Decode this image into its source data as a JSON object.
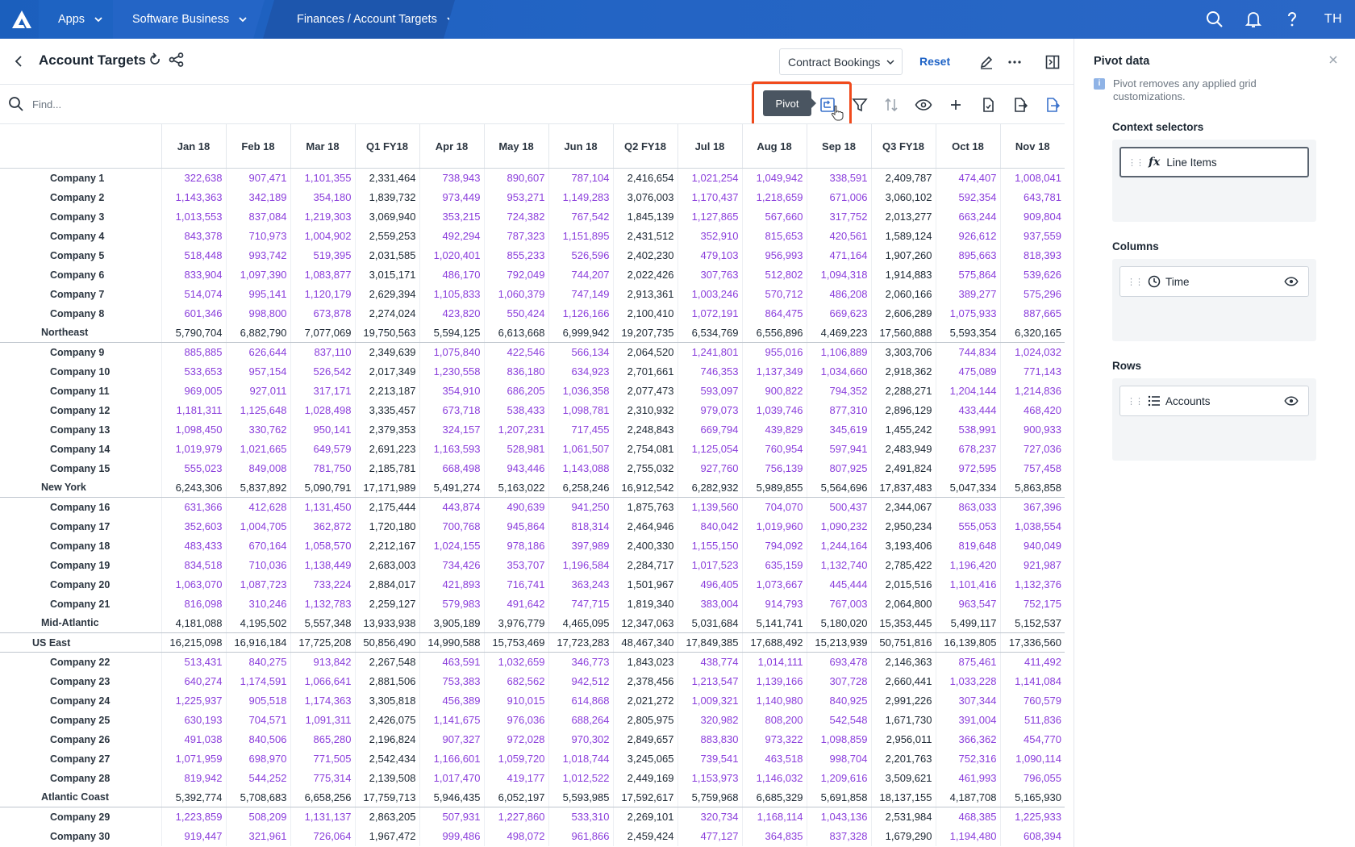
{
  "topnav": {
    "apps_label": "Apps",
    "workspace_label": "Software Business",
    "breadcrumb_label": "Finances / Account Targets",
    "user_initials": "TH"
  },
  "header": {
    "title": "Account Targets",
    "dropdown_value": "Contract Bookings",
    "reset_label": "Reset"
  },
  "toolbar": {
    "find_placeholder": "Find...",
    "tooltip": "Pivot"
  },
  "grid": {
    "columns": [
      "Jan 18",
      "Feb 18",
      "Mar 18",
      "Q1 FY18",
      "Apr 18",
      "May 18",
      "Jun 18",
      "Q2 FY18",
      "Jul 18",
      "Aug 18",
      "Sep 18",
      "Q3 FY18",
      "Oct 18",
      "Nov 18"
    ],
    "quarter_columns": [
      3,
      7,
      11
    ],
    "rows": [
      {
        "label": "Company 1",
        "type": "company",
        "values": [
          "322,638",
          "907,471",
          "1,101,355",
          "2,331,464",
          "738,943",
          "890,607",
          "787,104",
          "2,416,654",
          "1,021,254",
          "1,049,942",
          "338,591",
          "2,409,787",
          "474,407",
          "1,008,041"
        ]
      },
      {
        "label": "Company 2",
        "type": "company",
        "values": [
          "1,143,363",
          "342,189",
          "354,180",
          "1,839,732",
          "973,449",
          "953,271",
          "1,149,283",
          "3,076,003",
          "1,170,437",
          "1,218,659",
          "671,006",
          "3,060,102",
          "592,354",
          "643,781"
        ]
      },
      {
        "label": "Company 3",
        "type": "company",
        "values": [
          "1,013,553",
          "837,084",
          "1,219,303",
          "3,069,940",
          "353,215",
          "724,382",
          "767,542",
          "1,845,139",
          "1,127,865",
          "567,660",
          "317,752",
          "2,013,277",
          "663,244",
          "909,804"
        ]
      },
      {
        "label": "Company 4",
        "type": "company",
        "values": [
          "843,378",
          "710,973",
          "1,004,902",
          "2,559,253",
          "492,294",
          "787,323",
          "1,151,895",
          "2,431,512",
          "352,910",
          "815,653",
          "420,561",
          "1,589,124",
          "926,612",
          "937,559"
        ]
      },
      {
        "label": "Company 5",
        "type": "company",
        "values": [
          "518,448",
          "993,742",
          "519,395",
          "2,031,585",
          "1,020,401",
          "855,233",
          "526,596",
          "2,402,230",
          "479,103",
          "956,993",
          "471,164",
          "1,907,260",
          "895,663",
          "818,393"
        ]
      },
      {
        "label": "Company 6",
        "type": "company",
        "values": [
          "833,904",
          "1,097,390",
          "1,083,877",
          "3,015,171",
          "486,170",
          "792,049",
          "744,207",
          "2,022,426",
          "307,763",
          "512,802",
          "1,094,318",
          "1,914,883",
          "575,864",
          "539,626"
        ]
      },
      {
        "label": "Company 7",
        "type": "company",
        "values": [
          "514,074",
          "995,141",
          "1,120,179",
          "2,629,394",
          "1,105,833",
          "1,060,379",
          "747,149",
          "2,913,361",
          "1,003,246",
          "570,712",
          "486,208",
          "2,060,166",
          "389,277",
          "575,296"
        ]
      },
      {
        "label": "Company 8",
        "type": "company",
        "values": [
          "601,346",
          "998,800",
          "673,878",
          "2,274,024",
          "423,820",
          "550,424",
          "1,126,166",
          "2,100,410",
          "1,072,191",
          "864,475",
          "669,623",
          "2,606,289",
          "1,075,933",
          "887,665"
        ]
      },
      {
        "label": "Northeast",
        "type": "region",
        "values": [
          "5,790,704",
          "6,882,790",
          "7,077,069",
          "19,750,563",
          "5,594,125",
          "6,613,668",
          "6,999,942",
          "19,207,735",
          "6,534,769",
          "6,556,896",
          "4,469,223",
          "17,560,888",
          "5,593,354",
          "6,320,165"
        ]
      },
      {
        "label": "Company 9",
        "type": "company",
        "values": [
          "885,885",
          "626,644",
          "837,110",
          "2,349,639",
          "1,075,840",
          "422,546",
          "566,134",
          "2,064,520",
          "1,241,801",
          "955,016",
          "1,106,889",
          "3,303,706",
          "744,834",
          "1,024,032"
        ]
      },
      {
        "label": "Company 10",
        "type": "company",
        "values": [
          "533,653",
          "957,154",
          "526,542",
          "2,017,349",
          "1,230,558",
          "836,180",
          "634,923",
          "2,701,661",
          "746,353",
          "1,137,349",
          "1,034,660",
          "2,918,362",
          "475,089",
          "771,143"
        ]
      },
      {
        "label": "Company 11",
        "type": "company",
        "values": [
          "969,005",
          "927,011",
          "317,171",
          "2,213,187",
          "354,910",
          "686,205",
          "1,036,358",
          "2,077,473",
          "593,097",
          "900,822",
          "794,352",
          "2,288,271",
          "1,204,144",
          "1,214,836"
        ]
      },
      {
        "label": "Company 12",
        "type": "company",
        "values": [
          "1,181,311",
          "1,125,648",
          "1,028,498",
          "3,335,457",
          "673,718",
          "538,433",
          "1,098,781",
          "2,310,932",
          "979,073",
          "1,039,746",
          "877,310",
          "2,896,129",
          "433,444",
          "468,420"
        ]
      },
      {
        "label": "Company 13",
        "type": "company",
        "values": [
          "1,098,450",
          "330,762",
          "950,141",
          "2,379,353",
          "324,157",
          "1,207,231",
          "717,455",
          "2,248,843",
          "669,794",
          "439,829",
          "345,619",
          "1,455,242",
          "538,991",
          "900,933"
        ]
      },
      {
        "label": "Company 14",
        "type": "company",
        "values": [
          "1,019,979",
          "1,021,665",
          "649,579",
          "2,691,223",
          "1,163,593",
          "528,981",
          "1,061,507",
          "2,754,081",
          "1,125,054",
          "760,954",
          "597,941",
          "2,483,949",
          "678,237",
          "727,036"
        ]
      },
      {
        "label": "Company 15",
        "type": "company",
        "values": [
          "555,023",
          "849,008",
          "781,750",
          "2,185,781",
          "668,498",
          "943,446",
          "1,143,088",
          "2,755,032",
          "927,760",
          "756,139",
          "807,925",
          "2,491,824",
          "972,595",
          "757,458"
        ]
      },
      {
        "label": "New York",
        "type": "region",
        "values": [
          "6,243,306",
          "5,837,892",
          "5,090,791",
          "17,171,989",
          "5,491,274",
          "5,163,022",
          "6,258,246",
          "16,912,542",
          "6,282,932",
          "5,989,855",
          "5,564,696",
          "17,837,483",
          "5,047,334",
          "5,863,858"
        ]
      },
      {
        "label": "Company 16",
        "type": "company",
        "values": [
          "631,366",
          "412,628",
          "1,131,450",
          "2,175,444",
          "443,874",
          "490,639",
          "941,250",
          "1,875,763",
          "1,139,560",
          "704,070",
          "500,437",
          "2,344,067",
          "863,033",
          "367,396"
        ]
      },
      {
        "label": "Company 17",
        "type": "company",
        "values": [
          "352,603",
          "1,004,705",
          "362,872",
          "1,720,180",
          "700,768",
          "945,864",
          "818,314",
          "2,464,946",
          "840,042",
          "1,019,960",
          "1,090,232",
          "2,950,234",
          "555,053",
          "1,038,554"
        ]
      },
      {
        "label": "Company 18",
        "type": "company",
        "values": [
          "483,433",
          "670,164",
          "1,058,570",
          "2,212,167",
          "1,024,155",
          "978,186",
          "397,989",
          "2,400,330",
          "1,155,150",
          "794,092",
          "1,244,164",
          "3,193,406",
          "819,648",
          "940,049"
        ]
      },
      {
        "label": "Company 19",
        "type": "company",
        "values": [
          "834,518",
          "710,036",
          "1,138,449",
          "2,683,003",
          "734,426",
          "353,707",
          "1,196,584",
          "2,284,717",
          "1,017,523",
          "635,159",
          "1,132,740",
          "2,785,422",
          "1,196,420",
          "921,987"
        ]
      },
      {
        "label": "Company 20",
        "type": "company",
        "values": [
          "1,063,070",
          "1,087,723",
          "733,224",
          "2,884,017",
          "421,893",
          "716,741",
          "363,243",
          "1,501,967",
          "496,405",
          "1,073,667",
          "445,444",
          "2,015,516",
          "1,101,416",
          "1,132,376"
        ]
      },
      {
        "label": "Company 21",
        "type": "company",
        "values": [
          "816,098",
          "310,246",
          "1,132,783",
          "2,259,127",
          "579,983",
          "491,642",
          "747,715",
          "1,819,340",
          "383,004",
          "914,793",
          "767,003",
          "2,064,800",
          "963,547",
          "752,175"
        ]
      },
      {
        "label": "Mid-Atlantic",
        "type": "region",
        "values": [
          "4,181,088",
          "4,195,502",
          "5,557,348",
          "13,933,938",
          "3,905,189",
          "3,976,779",
          "4,465,095",
          "12,347,063",
          "5,031,684",
          "5,141,741",
          "5,180,020",
          "15,353,445",
          "5,499,117",
          "5,152,537"
        ]
      },
      {
        "label": "US East",
        "type": "total",
        "values": [
          "16,215,098",
          "16,916,184",
          "17,725,208",
          "50,856,490",
          "14,990,588",
          "15,753,469",
          "17,723,283",
          "48,467,340",
          "17,849,385",
          "17,688,492",
          "15,213,939",
          "50,751,816",
          "16,139,805",
          "17,336,560"
        ]
      },
      {
        "label": "Company 22",
        "type": "company",
        "values": [
          "513,431",
          "840,275",
          "913,842",
          "2,267,548",
          "463,591",
          "1,032,659",
          "346,773",
          "1,843,023",
          "438,774",
          "1,014,111",
          "693,478",
          "2,146,363",
          "875,461",
          "411,492"
        ]
      },
      {
        "label": "Company 23",
        "type": "company",
        "values": [
          "640,274",
          "1,174,591",
          "1,066,641",
          "2,881,506",
          "753,383",
          "682,562",
          "942,512",
          "2,378,456",
          "1,213,547",
          "1,139,166",
          "307,728",
          "2,660,441",
          "1,033,228",
          "1,141,084"
        ]
      },
      {
        "label": "Company 24",
        "type": "company",
        "values": [
          "1,225,937",
          "905,518",
          "1,174,363",
          "3,305,818",
          "456,389",
          "910,015",
          "614,868",
          "2,021,272",
          "1,009,321",
          "1,140,980",
          "840,925",
          "2,991,226",
          "307,344",
          "760,579"
        ]
      },
      {
        "label": "Company 25",
        "type": "company",
        "values": [
          "630,193",
          "704,571",
          "1,091,311",
          "2,426,075",
          "1,141,675",
          "976,036",
          "688,264",
          "2,805,975",
          "320,982",
          "808,200",
          "542,548",
          "1,671,730",
          "391,004",
          "511,836"
        ]
      },
      {
        "label": "Company 26",
        "type": "company",
        "values": [
          "491,038",
          "840,506",
          "865,280",
          "2,196,824",
          "907,327",
          "972,028",
          "970,302",
          "2,849,657",
          "883,830",
          "973,322",
          "1,098,859",
          "2,956,011",
          "366,362",
          "454,770"
        ]
      },
      {
        "label": "Company 27",
        "type": "company",
        "values": [
          "1,071,959",
          "698,970",
          "771,505",
          "2,542,434",
          "1,166,601",
          "1,059,720",
          "1,018,744",
          "3,245,065",
          "739,541",
          "463,518",
          "998,704",
          "2,201,763",
          "752,316",
          "1,090,114"
        ]
      },
      {
        "label": "Company 28",
        "type": "company",
        "values": [
          "819,942",
          "544,252",
          "775,314",
          "2,139,508",
          "1,017,470",
          "419,177",
          "1,012,522",
          "2,449,169",
          "1,153,973",
          "1,146,032",
          "1,209,616",
          "3,509,621",
          "461,993",
          "796,055"
        ]
      },
      {
        "label": "Atlantic Coast",
        "type": "region",
        "values": [
          "5,392,774",
          "5,708,683",
          "6,658,256",
          "17,759,713",
          "5,946,435",
          "6,052,197",
          "5,593,985",
          "17,592,617",
          "5,759,968",
          "6,685,329",
          "5,691,858",
          "18,137,155",
          "4,187,708",
          "5,165,930"
        ]
      },
      {
        "label": "Company 29",
        "type": "company",
        "values": [
          "1,223,859",
          "508,209",
          "1,131,137",
          "2,863,205",
          "507,931",
          "1,227,860",
          "533,310",
          "2,269,101",
          "320,734",
          "1,168,114",
          "1,043,136",
          "2,531,984",
          "468,385",
          "1,225,933"
        ]
      },
      {
        "label": "Company 30",
        "type": "company",
        "values": [
          "919,447",
          "321,961",
          "726,064",
          "1,967,472",
          "999,486",
          "498,072",
          "961,866",
          "2,459,424",
          "477,127",
          "364,835",
          "837,328",
          "1,679,290",
          "1,194,480",
          "608,394"
        ]
      }
    ]
  },
  "panel": {
    "title": "Pivot data",
    "note": "Pivot removes any applied grid customizations.",
    "context_label": "Context selectors",
    "context_chip": "Line Items",
    "context_chip_icon": "fx",
    "columns_label": "Columns",
    "columns_chip": "Time",
    "rows_label": "Rows",
    "rows_chip": "Accounts"
  },
  "colors": {
    "nav_blue": "#1e63c2",
    "input_value_purple": "#8a3ddb",
    "link_blue": "#1f63c6",
    "highlight_orange": "#f04a1c"
  }
}
